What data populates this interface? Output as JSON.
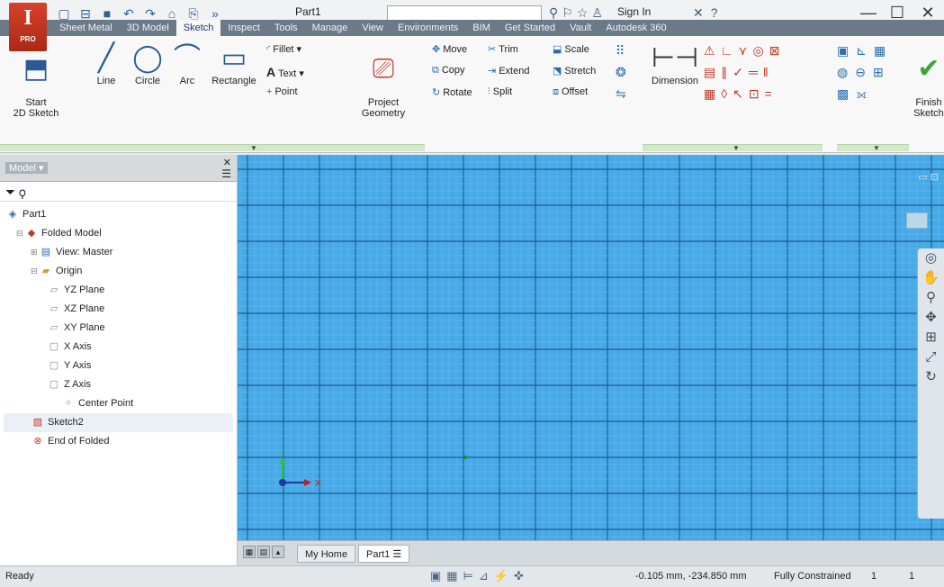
{
  "titlebar": {
    "app_letter": "I",
    "app_edition": "PRO",
    "doc_title": "Part1",
    "search_placeholder": "",
    "sign_in": "Sign In",
    "minimize": "—",
    "maximize": "☐",
    "close": "✕"
  },
  "tabs": [
    {
      "label": "Sheet Metal"
    },
    {
      "label": "3D Model"
    },
    {
      "label": "Sketch"
    },
    {
      "label": "Inspect"
    },
    {
      "label": "Tools"
    },
    {
      "label": "Manage"
    },
    {
      "label": "View"
    },
    {
      "label": "Environments"
    },
    {
      "label": "BIM"
    },
    {
      "label": "Get Started"
    },
    {
      "label": "Vault"
    },
    {
      "label": "Autodesk 360"
    }
  ],
  "ribbon": {
    "start_2d_sketch": "Start\n2D Sketch",
    "line": "Line",
    "circle": "Circle",
    "arc": "Arc",
    "rectangle": "Rectangle",
    "fillet": "Fillet",
    "text": "Text",
    "point": "Point",
    "project_geometry": "Project\nGeometry",
    "move": "Move",
    "copy": "Copy",
    "rotate": "Rotate",
    "trim": "Trim",
    "extend": "Extend",
    "split": "Split",
    "scale": "Scale",
    "stretch": "Stretch",
    "offset": "Offset",
    "dimension": "Dimension",
    "finish_sketch": "Finish\nSketch"
  },
  "browser": {
    "title": "Model",
    "tree": [
      {
        "label": "Part1",
        "level": 0,
        "icon": "part-icon"
      },
      {
        "label": "Folded Model",
        "level": 1,
        "icon": "folded-model-icon"
      },
      {
        "label": "View: Master",
        "level": 2,
        "icon": "view-icon"
      },
      {
        "label": "Origin",
        "level": 2,
        "icon": "folder-icon"
      },
      {
        "label": "YZ Plane",
        "level": 3,
        "icon": "plane-icon"
      },
      {
        "label": "XZ Plane",
        "level": 3,
        "icon": "plane-icon"
      },
      {
        "label": "XY Plane",
        "level": 3,
        "icon": "plane-icon"
      },
      {
        "label": "X Axis",
        "level": 3,
        "icon": "axis-icon"
      },
      {
        "label": "Y Axis",
        "level": 3,
        "icon": "axis-icon"
      },
      {
        "label": "Z Axis",
        "level": 3,
        "icon": "axis-icon"
      },
      {
        "label": "Center Point",
        "level": 4,
        "icon": "center-point-icon"
      },
      {
        "label": "Sketch2",
        "level": 2,
        "icon": "sketch-icon"
      },
      {
        "label": "End of Folded",
        "level": 2,
        "icon": "end-of-part-icon"
      }
    ]
  },
  "doctabs": {
    "home": "My Home",
    "part": "Part1"
  },
  "canvas": {
    "axis_x": "X",
    "axis_y": "Y"
  },
  "status": {
    "text": "Ready",
    "coordinates": "-0.105 mm, -234.850 mm",
    "constraint": "Fully Constrained",
    "count1": "1",
    "count2": "1"
  },
  "colors": {
    "canvas_bg": "#47a9e8",
    "tab_bar": "#6a7a89",
    "accent_red": "#d8402a"
  }
}
